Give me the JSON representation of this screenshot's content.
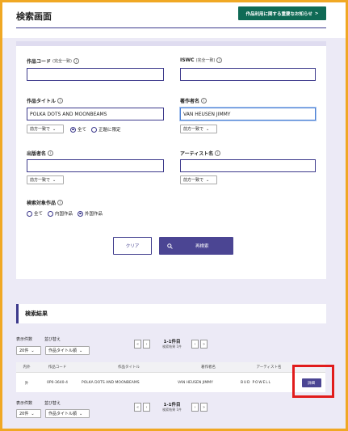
{
  "header": {
    "title": "検索画面",
    "notice_button": "作品利用に関する重要なお知らせ",
    "notice_chevron": ">"
  },
  "form": {
    "work_code": {
      "label": "作品コード",
      "sub": "(完全一致)",
      "value": ""
    },
    "iswc": {
      "label": "ISWC",
      "sub": "(完全一致)",
      "value": ""
    },
    "work_title": {
      "label": "作品タイトル",
      "value": "POLKA DOTS AND MOONBEAMS",
      "match_select": "前方一致で",
      "radio_all": "全て",
      "radio_official": "正題に限定"
    },
    "author": {
      "label": "著作者名",
      "value": "VAN HEUSEN JIMMY",
      "match_select": "前方一致で"
    },
    "publisher": {
      "label": "出版者名",
      "value": "",
      "match_select": "前方一致で"
    },
    "artist": {
      "label": "アーティスト名",
      "value": "",
      "match_select": "前方一致で"
    },
    "target": {
      "label": "検索対象作品",
      "opt_all": "全て",
      "opt_domestic": "内国作品",
      "opt_foreign": "外国作品",
      "selected": "外国作品"
    },
    "clear_button": "クリア",
    "search_button": "再検索"
  },
  "results": {
    "title": "検索結果",
    "display_count_label": "表示件数",
    "sort_label": "並び替え",
    "display_count_value": "20件",
    "sort_value": "作品タイトル順",
    "page_info": "1-1件目",
    "total_info": "検索結果 1件",
    "pager": {
      "first": "«",
      "prev": "‹",
      "next": "›",
      "last": "»"
    },
    "columns": [
      "内外",
      "作品コード",
      "作品タイトル",
      "著作者名",
      "アーティスト名",
      ""
    ],
    "rows": [
      {
        "kind": "外",
        "code": "0P0-3640-4",
        "title": "POLKA DOTS AND MOONBEAMS",
        "author": "VAN HEUSEN JIMMY",
        "artist": "BUD POWELL",
        "action": "詳細"
      }
    ]
  },
  "icons": {
    "info": "info-icon",
    "search": "search-icon",
    "chevron_down": "chevron-down-icon"
  },
  "colors": {
    "accent": "#3d3a8c",
    "notice": "#0f6a55",
    "primary_button": "#4b4593",
    "highlight": "#e11c1c"
  }
}
